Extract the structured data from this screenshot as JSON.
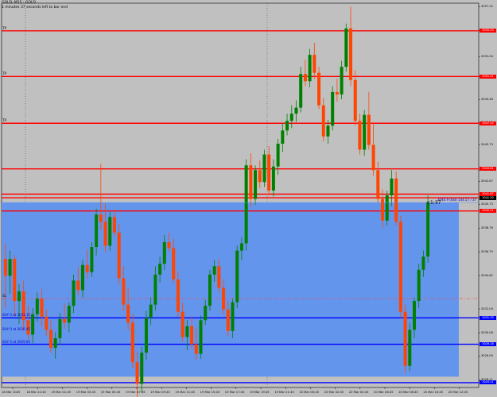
{
  "header": {
    "title": "GOLD, M15 : GOLD",
    "countdown": "1 minutes 37 seconds left to bar end"
  },
  "chart_data": {
    "type": "candlestick",
    "symbol": "GOLD",
    "timeframe": "M15",
    "ylim": [
      3025.5,
      3057.5
    ],
    "y_ticks": [
      "3057.22",
      "3055.20",
      "3053.04",
      "3051.37",
      "3049.46",
      "3047.52",
      "3045.73",
      "3043.61",
      "3042.67",
      "3040.73",
      "3038.76",
      "3036.79",
      "3034.82",
      "3032.04",
      "3030.06",
      "3028.09",
      "3026.11",
      "3025.21",
      "3027.18"
    ],
    "x_labels": [
      "18 Mar 2025",
      "18 Mar 22:45",
      "19 Mar 01:45",
      "19 Mar 03:45",
      "19 Mar 05:45",
      "19 Mar 07:45",
      "19 Mar 09:45",
      "19 Mar 11:45",
      "19 Mar 15:45",
      "19 Mar 17:45",
      "19 Mar 19:45",
      "19 Mar 21:45",
      "20 Mar 00:45",
      "20 Mar 02:45",
      "20 Mar 04:45",
      "20 Mar 06:45",
      "20 Mar 08:45",
      "20 Mar 10:45",
      "20 Mar 12:45"
    ],
    "candles": [
      [
        3036.2,
        3037.5,
        3032.1,
        3034.8
      ],
      [
        3034.8,
        3036.9,
        3033.3,
        3036.2
      ],
      [
        3036.2,
        3036.5,
        3031.4,
        3032.7
      ],
      [
        3032.7,
        3034.1,
        3030.8,
        3033.5
      ],
      [
        3033.5,
        3034.4,
        3030.2,
        3031.1
      ],
      [
        3031.1,
        3032.3,
        3029.5,
        3029.9
      ],
      [
        3029.9,
        3032.1,
        3029.2,
        3031.6
      ],
      [
        3031.6,
        3033.4,
        3031.0,
        3032.9
      ],
      [
        3032.9,
        3033.7,
        3030.6,
        3031.4
      ],
      [
        3031.4,
        3032.0,
        3029.8,
        3030.3
      ],
      [
        3030.3,
        3031.1,
        3028.4,
        3028.8
      ],
      [
        3028.8,
        3030.1,
        3027.9,
        3029.6
      ],
      [
        3029.6,
        3031.7,
        3029.1,
        3031.2
      ],
      [
        3031.2,
        3032.5,
        3030.4,
        3030.9
      ],
      [
        3030.9,
        3032.6,
        3030.1,
        3032.3
      ],
      [
        3032.3,
        3034.9,
        3031.7,
        3034.4
      ],
      [
        3034.4,
        3035.5,
        3033.2,
        3033.6
      ],
      [
        3033.6,
        3036.1,
        3033.0,
        3035.7
      ],
      [
        3035.7,
        3037.0,
        3034.6,
        3035.1
      ],
      [
        3035.1,
        3037.6,
        3034.7,
        3037.2
      ],
      [
        3037.2,
        3040.4,
        3036.5,
        3039.9
      ],
      [
        3039.9,
        3044.1,
        3038.6,
        3039.3
      ],
      [
        3039.3,
        3040.8,
        3036.8,
        3037.3
      ],
      [
        3037.3,
        3040.1,
        3036.9,
        3039.7
      ],
      [
        3039.7,
        3040.3,
        3038.1,
        3038.4
      ],
      [
        3038.4,
        3039.1,
        3034.1,
        3034.6
      ],
      [
        3034.6,
        3035.6,
        3031.9,
        3032.4
      ],
      [
        3032.4,
        3033.8,
        3030.3,
        3030.9
      ],
      [
        3030.9,
        3031.6,
        3027.1,
        3027.6
      ],
      [
        3027.6,
        3028.5,
        3024.3,
        3025.8
      ],
      [
        3025.8,
        3028.9,
        3025.1,
        3028.4
      ],
      [
        3028.4,
        3031.9,
        3027.8,
        3031.3
      ],
      [
        3031.3,
        3033.0,
        3030.7,
        3032.4
      ],
      [
        3032.4,
        3035.6,
        3031.9,
        3034.9
      ],
      [
        3034.9,
        3036.4,
        3034.2,
        3035.8
      ],
      [
        3035.8,
        3038.2,
        3035.3,
        3037.6
      ],
      [
        3037.6,
        3038.4,
        3036.8,
        3037.1
      ],
      [
        3037.1,
        3037.9,
        3034.2,
        3034.5
      ],
      [
        3034.5,
        3035.2,
        3031.4,
        3031.8
      ],
      [
        3031.8,
        3032.6,
        3029.3,
        3029.7
      ],
      [
        3029.7,
        3031.1,
        3028.6,
        3030.6
      ],
      [
        3030.6,
        3031.4,
        3028.7,
        3029.1
      ],
      [
        3029.1,
        3030.4,
        3027.8,
        3028.3
      ],
      [
        3028.3,
        3031.5,
        3027.9,
        3031.1
      ],
      [
        3031.1,
        3032.8,
        3030.7,
        3032.3
      ],
      [
        3032.3,
        3035.3,
        3031.9,
        3034.9
      ],
      [
        3034.9,
        3036.1,
        3034.3,
        3035.6
      ],
      [
        3035.6,
        3036.2,
        3033.4,
        3033.8
      ],
      [
        3033.8,
        3034.5,
        3031.6,
        3032.0
      ],
      [
        3032.0,
        3032.7,
        3029.8,
        3030.2
      ],
      [
        3030.2,
        3032.9,
        3029.6,
        3032.6
      ],
      [
        3032.6,
        3037.3,
        3032.1,
        3036.9
      ],
      [
        3036.9,
        3038.0,
        3036.1,
        3037.5
      ],
      [
        3037.5,
        3044.5,
        3036.9,
        3044.0
      ],
      [
        3044.0,
        3045.0,
        3040.5,
        3041.2
      ],
      [
        3041.2,
        3044.0,
        3040.7,
        3043.6
      ],
      [
        3043.6,
        3044.4,
        3042.1,
        3042.6
      ],
      [
        3042.6,
        3045.3,
        3042.2,
        3044.9
      ],
      [
        3044.9,
        3045.6,
        3041.5,
        3041.9
      ],
      [
        3041.9,
        3044.5,
        3041.4,
        3043.9
      ],
      [
        3043.9,
        3046.2,
        3043.2,
        3045.8
      ],
      [
        3045.8,
        3047.5,
        3045.1,
        3046.9
      ],
      [
        3046.9,
        3048.3,
        3046.5,
        3047.7
      ],
      [
        3047.7,
        3049.0,
        3047.1,
        3048.3
      ],
      [
        3048.3,
        3049.4,
        3047.6,
        3048.8
      ],
      [
        3048.8,
        3052.2,
        3048.4,
        3051.6
      ],
      [
        3051.6,
        3052.8,
        3050.6,
        3051.0
      ],
      [
        3051.0,
        3053.7,
        3050.5,
        3053.2
      ],
      [
        3053.2,
        3054.2,
        3051.2,
        3051.7
      ],
      [
        3051.7,
        3052.2,
        3048.7,
        3049.0
      ],
      [
        3049.0,
        3049.6,
        3046.0,
        3046.4
      ],
      [
        3046.4,
        3047.8,
        3045.8,
        3047.3
      ],
      [
        3047.3,
        3050.6,
        3046.9,
        3050.1
      ],
      [
        3050.1,
        3051.2,
        3049.3,
        3049.9
      ],
      [
        3049.9,
        3052.7,
        3049.5,
        3052.2
      ],
      [
        3052.2,
        3055.8,
        3051.8,
        3055.4
      ],
      [
        3055.4,
        3057.2,
        3050.6,
        3051.1
      ],
      [
        3051.1,
        3051.9,
        3047.3,
        3047.7
      ],
      [
        3047.7,
        3048.3,
        3044.9,
        3045.3
      ],
      [
        3045.3,
        3048.6,
        3044.8,
        3048.2
      ],
      [
        3048.2,
        3050.1,
        3045.3,
        3045.7
      ],
      [
        3045.7,
        3047.6,
        3043.1,
        3043.6
      ],
      [
        3043.6,
        3044.3,
        3040.9,
        3041.2
      ],
      [
        3041.2,
        3042.0,
        3038.8,
        3039.4
      ],
      [
        3039.4,
        3041.9,
        3039.0,
        3041.5
      ],
      [
        3041.5,
        3043.6,
        3040.6,
        3042.9
      ],
      [
        3042.9,
        3043.5,
        3039.0,
        3039.3
      ],
      [
        3039.3,
        3039.8,
        3031.3,
        3031.8
      ],
      [
        3031.8,
        3032.4,
        3026.7,
        3027.3
      ],
      [
        3027.3,
        3030.9,
        3026.9,
        3030.3
      ],
      [
        3030.3,
        3033.0,
        3029.6,
        3032.7
      ],
      [
        3032.7,
        3035.8,
        3032.1,
        3035.3
      ],
      [
        3035.3,
        3036.9,
        3034.7,
        3036.4
      ],
      [
        3036.4,
        3041.5,
        3035.9,
        3040.9
      ]
    ],
    "bull_color": "#008000",
    "bear_color": "#ff4500",
    "background_color": "#c0c0c0",
    "box": {
      "x_start_index": 0,
      "x_end_index": 95,
      "y_top": 3040.9,
      "y_bottom": 3026.4,
      "color": "#6495ed"
    },
    "bid_price": 3040.9,
    "bid_label": "3040.9 (Bid) 144.57 / 37",
    "timer": "<1:37",
    "red_levels": [
      {
        "value": 3055.2,
        "label": "TP"
      },
      {
        "value": 3051.4,
        "label": "TP"
      },
      {
        "value": 3047.5,
        "label": "TP"
      },
      {
        "value": 3043.7,
        "label": ""
      },
      {
        "value": 3041.6,
        "label": ""
      },
      {
        "value": 3041.3,
        "label": ""
      },
      {
        "value": 3040.2,
        "label": ""
      }
    ],
    "dashdot_level": {
      "value": 3032.9,
      "label": "SL"
    },
    "blue_levels": [
      {
        "value": 3031.3,
        "label": "BUY 0 at 3031.35"
      },
      {
        "value": 3029.1,
        "label": "BUY 0 at 3029.85"
      },
      {
        "value": 3025.9,
        "label": ""
      }
    ],
    "buy_text_only": {
      "value": 3030.1,
      "label": "BUY 0 at 3030.45"
    },
    "price_flags": [
      {
        "value": 3055.2,
        "text": "3055.20",
        "color": "#ff0000"
      },
      {
        "value": 3051.4,
        "text": "3051.41",
        "color": "#ff0000"
      },
      {
        "value": 3047.5,
        "text": "3047.52",
        "color": "#ff0000"
      },
      {
        "value": 3043.7,
        "text": "3043.61",
        "color": "#ff0000"
      },
      {
        "value": 3041.6,
        "text": "3041.67",
        "color": "#ff0000"
      },
      {
        "value": 3041.3,
        "text": "3041.30",
        "color": "#000000"
      },
      {
        "value": 3040.2,
        "text": "3040.21",
        "color": "#ff0000"
      },
      {
        "value": 3031.3,
        "text": "3031.35",
        "color": "#0000ff"
      },
      {
        "value": 3029.1,
        "text": "3029.18",
        "color": "#0000ff"
      },
      {
        "value": 3025.9,
        "text": "3025.21",
        "color": "#0000ff"
      }
    ]
  }
}
